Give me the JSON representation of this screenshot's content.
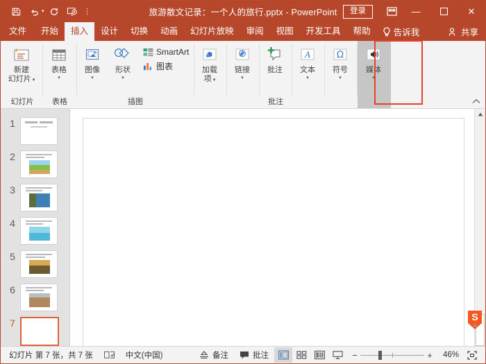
{
  "titlebar": {
    "document_title": "旅游散文记录：一个人的旅行.pptx  -  PowerPoint",
    "quick_access": [
      {
        "name": "save",
        "icon": "save-icon"
      },
      {
        "name": "undo",
        "icon": "undo-icon"
      },
      {
        "name": "redo",
        "icon": "redo-icon"
      },
      {
        "name": "start-slideshow",
        "icon": "slideshow-icon"
      },
      {
        "name": "customize-qat",
        "icon": "chevron-down-icon"
      }
    ],
    "signin_label": "登录",
    "ribbon_display_options": "ribbon-display-icon",
    "minimize": "—",
    "maximize": "❐",
    "close": "✕"
  },
  "tabs": [
    {
      "label": "文件",
      "active": false
    },
    {
      "label": "开始",
      "active": false
    },
    {
      "label": "插入",
      "active": true
    },
    {
      "label": "设计",
      "active": false
    },
    {
      "label": "切换",
      "active": false
    },
    {
      "label": "动画",
      "active": false
    },
    {
      "label": "幻灯片放映",
      "active": false
    },
    {
      "label": "审阅",
      "active": false
    },
    {
      "label": "视图",
      "active": false
    },
    {
      "label": "开发工具",
      "active": false
    },
    {
      "label": "帮助",
      "active": false
    }
  ],
  "tellme_label": "告诉我",
  "share_label": "共享",
  "ribbon": {
    "groups": [
      {
        "label": "幻灯片",
        "buttons": [
          {
            "label": "新建\n幻灯片",
            "line1": "新建",
            "line2": "幻灯片",
            "icon": "new-slide-icon",
            "dropdown": true
          }
        ]
      },
      {
        "label": "表格",
        "buttons": [
          {
            "label": "表格",
            "icon": "table-icon",
            "dropdown": true
          }
        ]
      },
      {
        "label": "插图",
        "buttons": [
          {
            "label": "图像",
            "icon": "images-icon",
            "dropdown": true
          },
          {
            "label": "形状",
            "icon": "shapes-icon",
            "dropdown": true
          }
        ],
        "small_buttons": [
          {
            "label": "SmartArt",
            "icon": "smartart-icon"
          },
          {
            "label": "图表",
            "icon": "chart-icon"
          }
        ]
      },
      {
        "label": "",
        "buttons": [
          {
            "label": "加载\n项",
            "line1": "加载",
            "line2": "项",
            "icon": "addins-icon",
            "dropdown": true
          }
        ]
      },
      {
        "label": "",
        "buttons": [
          {
            "label": "链接",
            "icon": "link-icon",
            "dropdown": true
          }
        ]
      },
      {
        "label": "批注",
        "buttons": [
          {
            "label": "批注",
            "icon": "comment-icon",
            "dropdown": false
          }
        ]
      },
      {
        "label": "",
        "buttons": [
          {
            "label": "文本",
            "icon": "text-icon",
            "dropdown": true
          }
        ]
      },
      {
        "label": "",
        "buttons": [
          {
            "label": "符号",
            "icon": "symbol-icon",
            "dropdown": true
          }
        ]
      },
      {
        "label": "",
        "buttons": [
          {
            "label": "媒体",
            "icon": "media-icon",
            "dropdown": true,
            "selected": true,
            "annotated": true
          }
        ]
      }
    ],
    "annotation_color": "#e8402a",
    "collapse_icon": "chevron-up-icon"
  },
  "thumbnails": [
    {
      "number": "1",
      "selected": false,
      "has_image": false,
      "type": "title"
    },
    {
      "number": "2",
      "selected": false,
      "has_image": true,
      "image": "green-field-road"
    },
    {
      "number": "3",
      "selected": false,
      "has_image": true,
      "image": "coastal-cliff"
    },
    {
      "number": "4",
      "selected": false,
      "has_image": true,
      "image": "turquoise-sea-boat"
    },
    {
      "number": "5",
      "selected": false,
      "has_image": true,
      "image": "sunset-hill"
    },
    {
      "number": "6",
      "selected": false,
      "has_image": true,
      "image": "desert-dunes"
    },
    {
      "number": "7",
      "selected": true,
      "has_image": false,
      "type": "blank"
    }
  ],
  "statusbar": {
    "slide_info": "幻灯片 第 7 张，共 7 张",
    "spellcheck_icon": "spellcheck-icon",
    "language": "中文(中国)",
    "notes_label": "备注",
    "notes_icon": "notes-icon",
    "comments_label": "批注",
    "comments_icon": "comment-bubble-icon",
    "views": [
      {
        "name": "normal-view",
        "icon": "normal-view-icon",
        "active": true
      },
      {
        "name": "slide-sorter-view",
        "icon": "sorter-view-icon",
        "active": false
      },
      {
        "name": "reading-view",
        "icon": "reading-view-icon",
        "active": false
      },
      {
        "name": "slideshow-view",
        "icon": "slideshow-view-icon",
        "active": false
      }
    ],
    "zoom_out": "−",
    "zoom_in": "+",
    "zoom_value": "46%",
    "fit_slide_icon": "fit-to-window-icon"
  },
  "colors": {
    "brand": "#b7472a",
    "ribbon_bg": "#f3f3f3",
    "thumb_pane_bg": "#e2e2e2",
    "selection": "#e1603a",
    "annotation": "#e8402a"
  }
}
